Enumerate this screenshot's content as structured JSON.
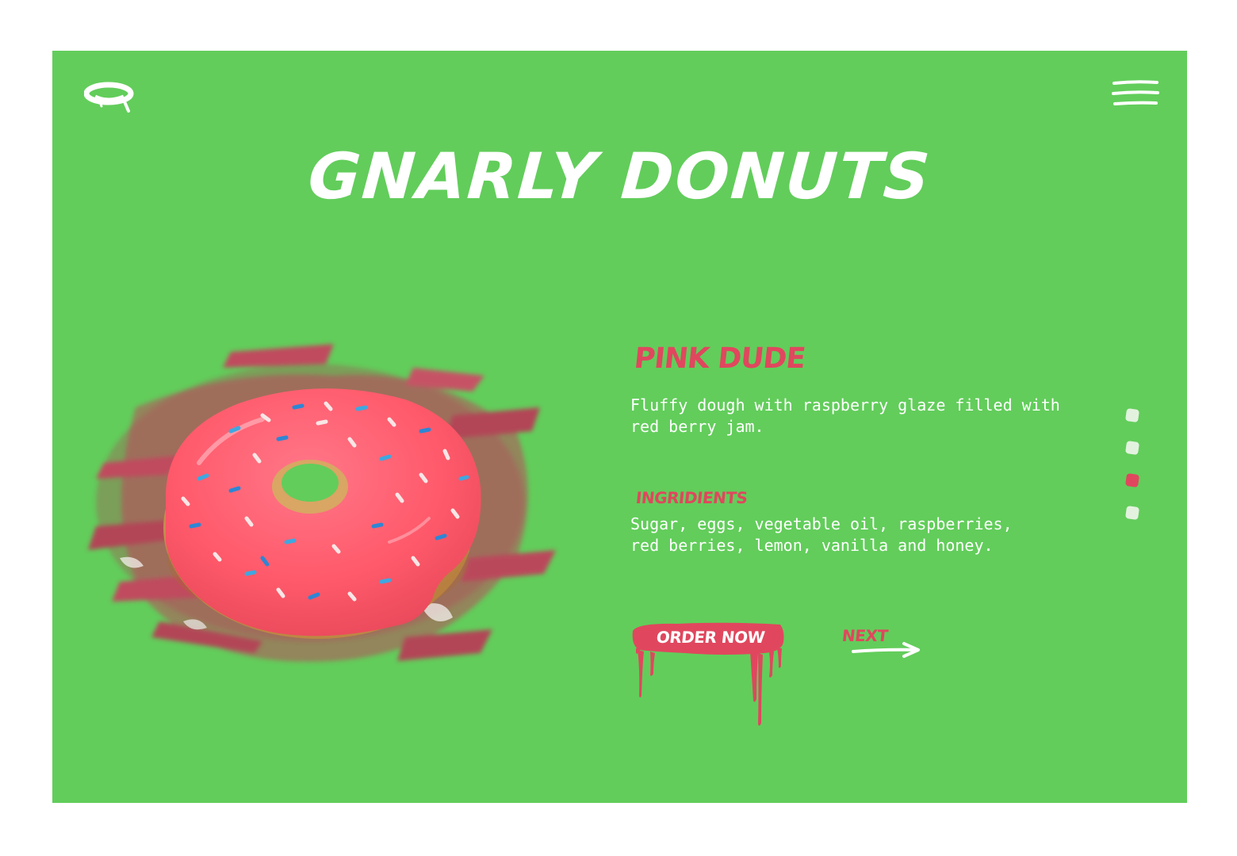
{
  "brand": {
    "title": "GNARLY DONUTS",
    "logo_icon": "glazed-ring-logo-icon",
    "menu_icon": "hamburger-menu-icon"
  },
  "colors": {
    "background": "#62cd5b",
    "accent": "#e0475e",
    "text": "#ffffff",
    "dot_inactive": "#e3f2df"
  },
  "product": {
    "name": "PINK DUDE",
    "description": "Fluffy dough with raspberry glaze filled with red berry jam.",
    "ingredients_label": "INGRIDIENTS",
    "ingredients": "Sugar, eggs, vegetable oil, raspberries, red berries, lemon, vanilla and honey.",
    "image_icon": "pink-sprinkle-donut-image"
  },
  "actions": {
    "order_label": "ORDER NOW",
    "next_label": "NEXT",
    "next_icon": "arrow-right-icon"
  },
  "pagination": {
    "count": 4,
    "active_index": 2
  }
}
